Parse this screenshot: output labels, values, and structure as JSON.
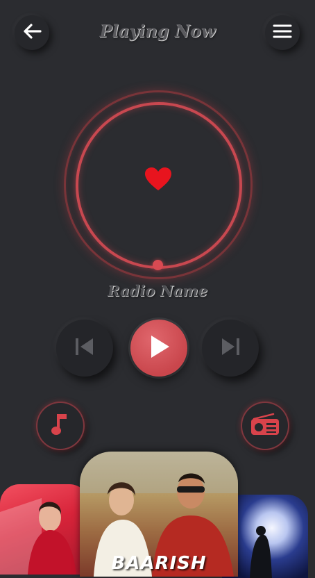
{
  "header": {
    "title": "Playing Now",
    "back_icon": "arrow-left-icon",
    "menu_icon": "hamburger-menu-icon"
  },
  "player": {
    "center_icon": "heart-icon",
    "station_name": "Radio Name",
    "accent_color": "#c84850"
  },
  "controls": {
    "previous_icon": "skip-previous-icon",
    "play_icon": "play-icon",
    "next_icon": "skip-next-icon"
  },
  "shortcuts": {
    "music_icon": "music-note-icon",
    "radio_icon": "radio-icon"
  },
  "carousel": {
    "main_card_title": "BAARISH"
  }
}
